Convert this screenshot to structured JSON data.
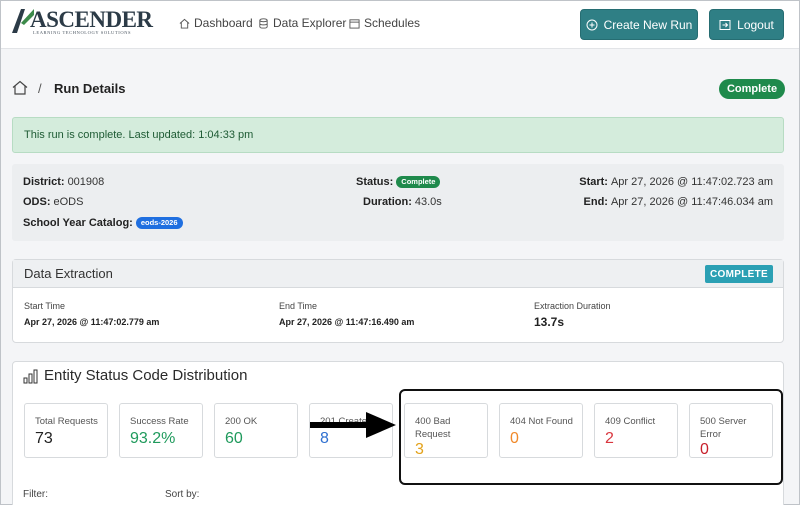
{
  "brand": {
    "name": "ASCENDER",
    "tagline": "LEARNING TECHNOLOGY SOLUTIONS",
    "accent": "#2f7f85"
  },
  "nav": {
    "links": [
      {
        "label": "Dashboard",
        "icon": "house-icon"
      },
      {
        "label": "Data Explorer",
        "icon": "database-icon"
      },
      {
        "label": "Schedules",
        "icon": "calendar-icon"
      }
    ],
    "create_label": "Create New Run",
    "logout_label": "Logout"
  },
  "header": {
    "separator": "/",
    "title": "Run Details",
    "status_pill": "Complete",
    "status_color": "#1f8a4c"
  },
  "alert": {
    "message": "This run is complete. Last updated: 1:04:33 pm"
  },
  "summary": {
    "district_label": "District:",
    "district": "001908",
    "ods_label": "ODS:",
    "ods": "eODS",
    "catalog_label": "School Year Catalog:",
    "catalog": "eods-2026",
    "status_label": "Status:",
    "status": "Complete",
    "duration_label": "Duration:",
    "duration": "43.0s",
    "start_label": "Start:",
    "start": "Apr 27, 2026 @ 11:47:02.723 am",
    "end_label": "End:",
    "end": "Apr 27, 2026 @ 11:47:46.034 am"
  },
  "extraction": {
    "title": "Data Extraction",
    "badge": "COMPLETE",
    "start_label": "Start Time",
    "start": "Apr 27, 2026 @ 11:47:02.779 am",
    "end_label": "End Time",
    "end": "Apr 27, 2026 @ 11:47:16.490 am",
    "duration_label": "Extraction Duration",
    "duration": "13.7s"
  },
  "distribution": {
    "title": "Entity Status Code Distribution",
    "stats": [
      {
        "label": "Total Requests",
        "value": "73",
        "color": "#222222"
      },
      {
        "label": "Success Rate",
        "value": "93.2%",
        "color": "#1f9a5c"
      },
      {
        "label": "200 OK",
        "value": "60",
        "color": "#1f9a5c"
      },
      {
        "label": "201 Created",
        "value": "8",
        "color": "#2e6fd0"
      },
      {
        "label": "400 Bad Request",
        "value": "3",
        "color": "#e3a21a"
      },
      {
        "label": "404 Not Found",
        "value": "0",
        "color": "#f0892a"
      },
      {
        "label": "409 Conflict",
        "value": "2",
        "color": "#d9363e"
      },
      {
        "label": "500 Server Error",
        "value": "0",
        "color": "#c7202b"
      }
    ],
    "filter_label": "Filter:",
    "sort_label": "Sort by:"
  }
}
